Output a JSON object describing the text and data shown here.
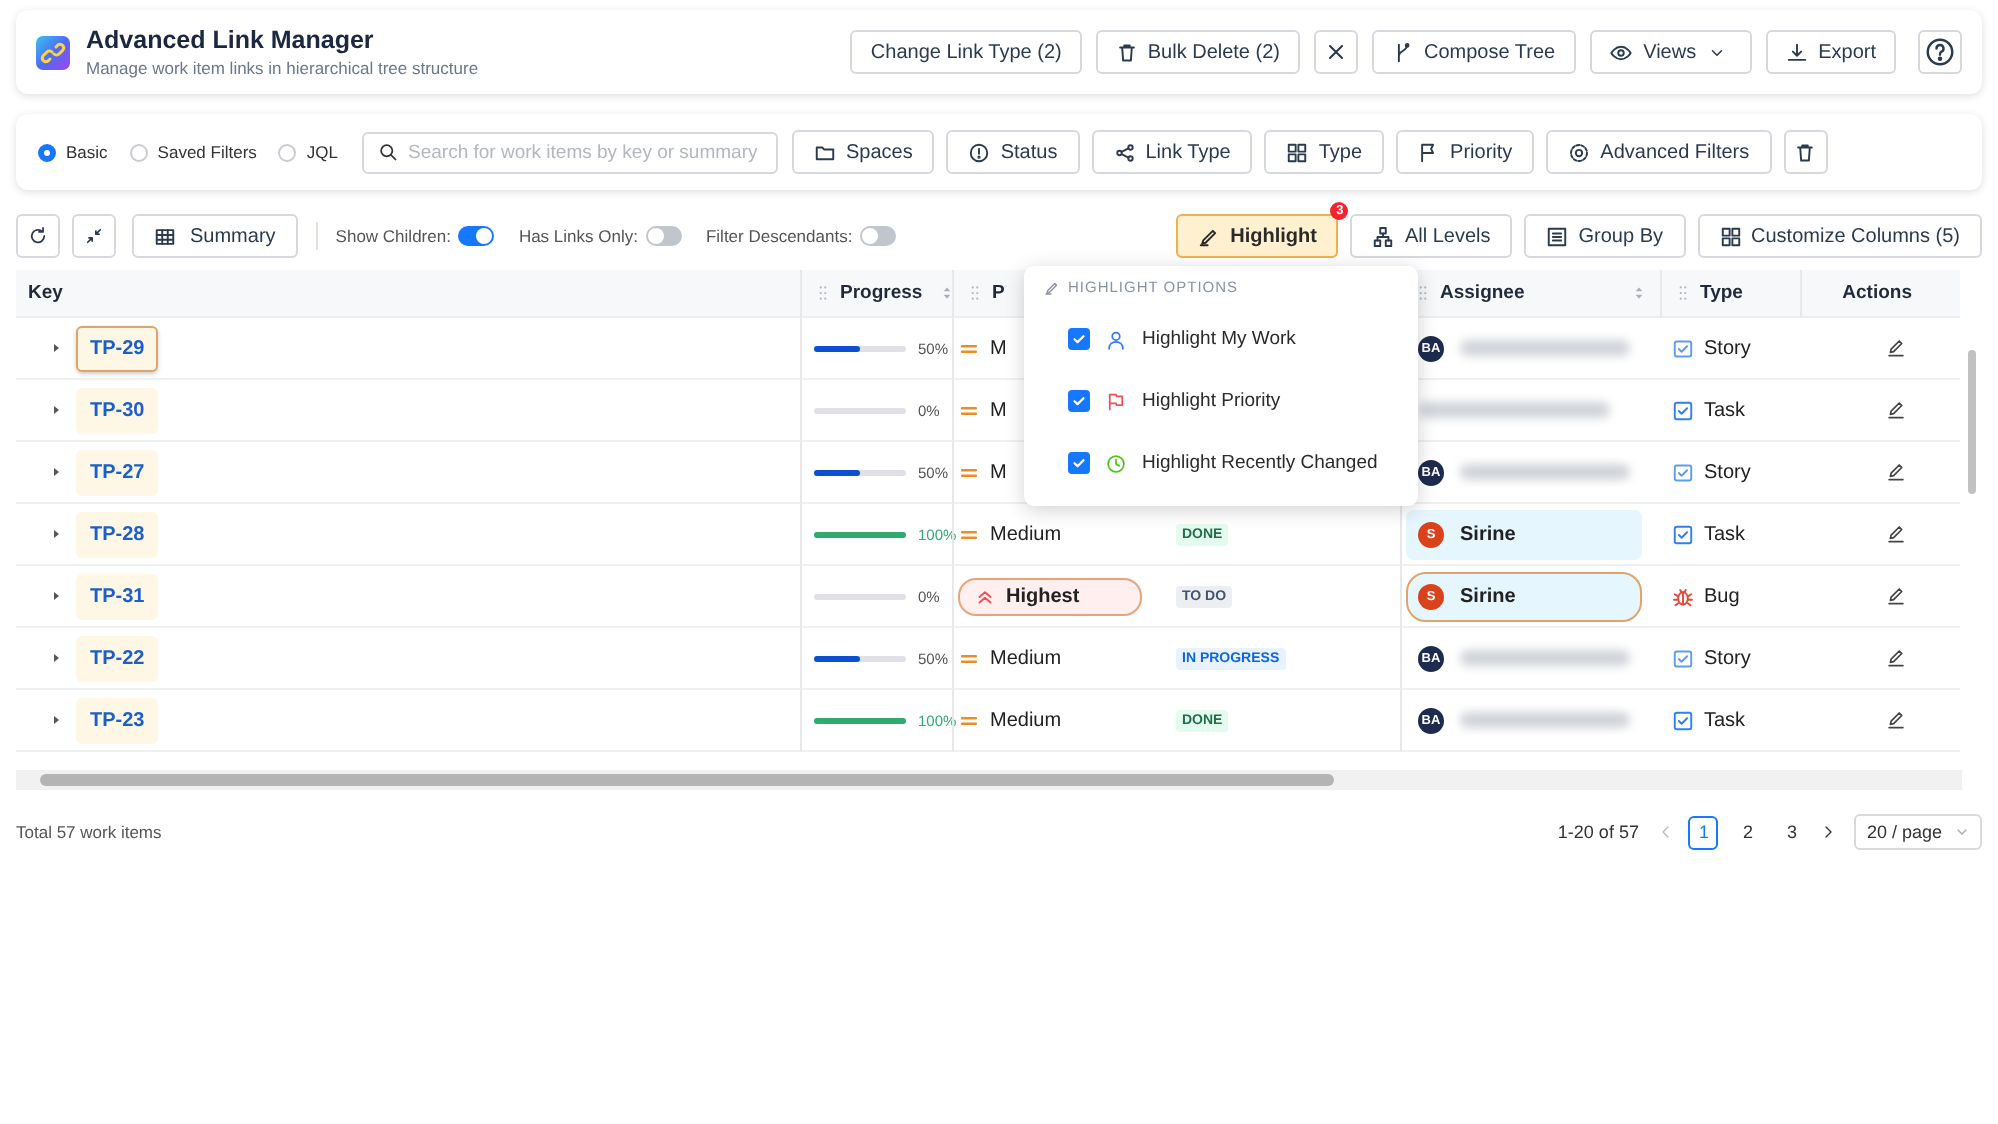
{
  "header": {
    "title": "Advanced Link Manager",
    "subtitle": "Manage work item links in hierarchical tree structure",
    "actions": [
      {
        "kind": "plain",
        "label": "Change Link Type (2)"
      },
      {
        "kind": "delete",
        "label": "Bulk Delete (2)"
      },
      {
        "kind": "close"
      },
      {
        "kind": "tree",
        "label": "Compose Tree"
      },
      {
        "kind": "views",
        "label": "Views"
      },
      {
        "kind": "export",
        "label": "Export"
      },
      {
        "kind": "help"
      }
    ]
  },
  "filters": {
    "modes": [
      {
        "label": "Basic",
        "selected": true
      },
      {
        "label": "Saved Filters",
        "selected": false
      },
      {
        "label": "JQL",
        "selected": false
      }
    ],
    "search": {
      "placeholder": "Search for work items by key or summary"
    },
    "buttons": [
      {
        "kind": "spaces",
        "label": "Spaces"
      },
      {
        "kind": "status",
        "label": "Status"
      },
      {
        "kind": "link",
        "label": "Link Type"
      },
      {
        "kind": "type",
        "label": "Type"
      },
      {
        "kind": "priority",
        "label": "Priority"
      },
      {
        "kind": "advanced",
        "label": "Advanced Filters"
      },
      {
        "kind": "clear"
      }
    ]
  },
  "toolbar": {
    "tools": [
      {
        "kind": "refresh"
      },
      {
        "kind": "collapse"
      },
      {
        "kind": "summary",
        "label": "Summary"
      }
    ],
    "toggles": [
      {
        "label": "Show Children:",
        "on": true
      },
      {
        "label": "Has Links Only:",
        "on": false
      },
      {
        "label": "Filter Descendants:",
        "on": false
      }
    ],
    "views": [
      {
        "kind": "highlight",
        "label": "Highlight",
        "active": true,
        "badge": "3"
      },
      {
        "kind": "levels",
        "label": "All Levels",
        "active": false
      },
      {
        "kind": "group",
        "label": "Group By",
        "active": false
      },
      {
        "kind": "columns",
        "label": "Customize Columns (5)",
        "active": false
      }
    ]
  },
  "table": {
    "columns": [
      {
        "kind": "key",
        "label": "Key",
        "handle": false,
        "sortable": false
      },
      {
        "kind": "progress",
        "label": "Progress",
        "handle": true,
        "sortable": true
      },
      {
        "kind": "priority",
        "label": "P",
        "handle": true,
        "sortable": false
      },
      {
        "kind": "assignee",
        "label": "Assignee",
        "handle": true,
        "sortable": true
      },
      {
        "kind": "type",
        "label": "Type",
        "handle": true,
        "sortable": false
      },
      {
        "kind": "actions",
        "label": "Actions",
        "handle": false,
        "sortable": false
      }
    ],
    "rows": [
      {
        "key": "TP-29",
        "outlined": true,
        "progress": {
          "level": 0.5,
          "reading": "50%"
        },
        "priority": {
          "kind": "medium",
          "label": "M",
          "outlined": false
        },
        "assignee": {
          "avatar": "BA",
          "color": "#1d2b4f",
          "blurred": true,
          "highlighted": false,
          "outlined": false
        },
        "type": {
          "kind": "story",
          "label": "Story"
        }
      },
      {
        "key": "TP-30",
        "outlined": false,
        "progress": {
          "level": 0,
          "reading": "0%"
        },
        "priority": {
          "kind": "medium",
          "label": "M",
          "outlined": false
        },
        "assignee": {
          "blurred": true,
          "highlighted": false,
          "outlined": false
        },
        "type": {
          "kind": "task",
          "label": "Task"
        }
      },
      {
        "key": "TP-27",
        "outlined": false,
        "progress": {
          "level": 0.5,
          "reading": "50%"
        },
        "priority": {
          "kind": "medium",
          "label": "M",
          "outlined": false
        },
        "assignee": {
          "avatar": "BA",
          "color": "#1d2b4f",
          "blurred": true,
          "highlighted": false,
          "outlined": false
        },
        "type": {
          "kind": "story",
          "label": "Story"
        }
      },
      {
        "key": "TP-28",
        "outlined": false,
        "progress": {
          "level": 1,
          "reading": "100%"
        },
        "priority": {
          "kind": "medium",
          "label": "Medium",
          "outlined": false
        },
        "status": {
          "kind": "done",
          "label": "DONE"
        },
        "assignee": {
          "avatar": "S",
          "color": "#d9421b",
          "name": "Sirine",
          "blurred": false,
          "highlighted": true,
          "outlined": false
        },
        "type": {
          "kind": "task",
          "label": "Task"
        }
      },
      {
        "key": "TP-31",
        "outlined": false,
        "progress": {
          "level": 0,
          "reading": "0%"
        },
        "priority": {
          "kind": "highest",
          "label": "Highest",
          "outlined": true
        },
        "status": {
          "kind": "todo",
          "label": "TO DO"
        },
        "assignee": {
          "avatar": "S",
          "color": "#d9421b",
          "name": "Sirine",
          "blurred": false,
          "highlighted": true,
          "outlined": true
        },
        "type": {
          "kind": "bug",
          "label": "Bug"
        }
      },
      {
        "key": "TP-22",
        "outlined": false,
        "progress": {
          "level": 0.5,
          "reading": "50%"
        },
        "priority": {
          "kind": "medium",
          "label": "Medium",
          "outlined": false
        },
        "status": {
          "kind": "progress",
          "label": "IN PROGRESS"
        },
        "assignee": {
          "avatar": "BA",
          "color": "#1d2b4f",
          "blurred": true,
          "highlighted": false,
          "outlined": false
        },
        "type": {
          "kind": "story",
          "label": "Story"
        }
      },
      {
        "key": "TP-23",
        "outlined": false,
        "progress": {
          "level": 1,
          "reading": "100%"
        },
        "priority": {
          "kind": "medium",
          "label": "Medium",
          "outlined": false
        },
        "status": {
          "kind": "done",
          "label": "DONE"
        },
        "assignee": {
          "avatar": "BA",
          "color": "#1d2b4f",
          "blurred": true,
          "highlighted": false,
          "outlined": false
        },
        "type": {
          "kind": "task",
          "label": "Task"
        }
      }
    ],
    "popup": {
      "title": "HIGHLIGHT OPTIONS",
      "options": [
        {
          "kind": "user",
          "label": "Highlight My Work",
          "checked": true
        },
        {
          "kind": "flag",
          "label": "Highlight Priority",
          "checked": true
        },
        {
          "kind": "clock",
          "label": "Highlight Recently Changed",
          "checked": true
        }
      ]
    }
  },
  "footer": {
    "total": "Total 57 work items",
    "range": "1-20 of 57",
    "pages": [
      {
        "label": "1",
        "selected": true
      },
      {
        "label": "2",
        "selected": false
      },
      {
        "label": "3",
        "selected": false
      }
    ],
    "page_size": "20 / page"
  }
}
